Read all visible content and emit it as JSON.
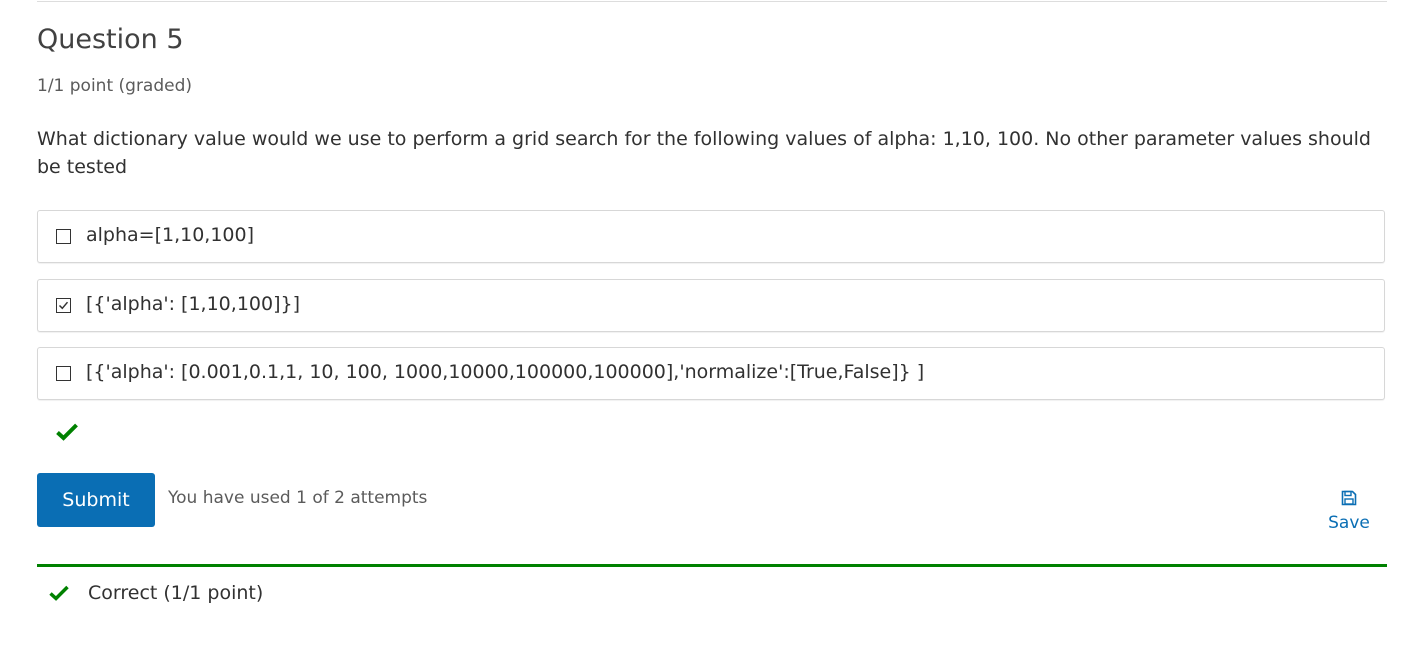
{
  "problem": {
    "title": "Question 5",
    "points": "1/1 point (graded)",
    "prompt": "What dictionary value would we use to perform a grid search for the following values of alpha: 1,10, 100. No other parameter values should be tested"
  },
  "choices": [
    {
      "label": "alpha=[1,10,100]",
      "checked": false
    },
    {
      "label": "[{'alpha': [1,10,100]}]",
      "checked": true
    },
    {
      "label": "[{'alpha': [0.001,0.1,1, 10, 100, 1000,10000,100000,100000],'normalize':[True,False]} ]",
      "checked": false
    }
  ],
  "actions": {
    "submit_label": "Submit",
    "attempts_text": "You have used 1 of 2 attempts",
    "save_label": "Save"
  },
  "feedback": {
    "text": "Correct (1/1 point)"
  },
  "colors": {
    "accent": "#0a6eb4",
    "success": "#008100"
  },
  "icons": {
    "status": "checkmark-icon",
    "save": "floppy-disk-icon",
    "feedback": "checkmark-icon"
  }
}
